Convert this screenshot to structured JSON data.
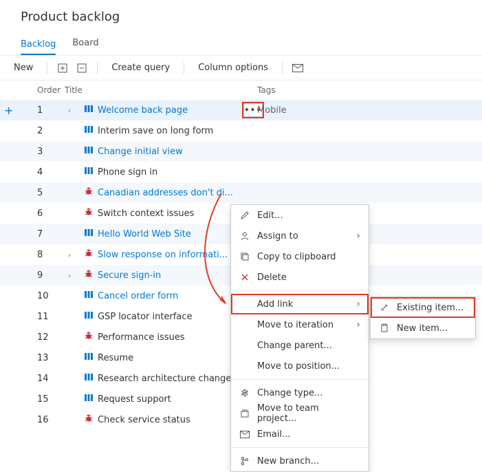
{
  "page": {
    "title": "Product backlog"
  },
  "tabs": {
    "active": "Backlog",
    "items": [
      "Backlog",
      "Board"
    ]
  },
  "toolbar": {
    "new": "New",
    "create_query": "Create query",
    "column_options": "Column options"
  },
  "columns": {
    "order": "Order",
    "title": "Title",
    "tags": "Tags"
  },
  "rows": [
    {
      "order": 1,
      "type": "pbi",
      "title": "Welcome back page",
      "link": true,
      "tag": "Mobile",
      "expand": true,
      "selected": true,
      "alt": true
    },
    {
      "order": 2,
      "type": "pbi",
      "title": "Interim save on long form"
    },
    {
      "order": 3,
      "type": "pbi",
      "title": "Change initial view",
      "link": true,
      "alt": true
    },
    {
      "order": 4,
      "type": "pbi",
      "title": "Phone sign in"
    },
    {
      "order": 5,
      "type": "bug",
      "title": "Canadian addresses don't di...",
      "link": true,
      "alt": true
    },
    {
      "order": 6,
      "type": "bug",
      "title": "Switch context issues"
    },
    {
      "order": 7,
      "type": "pbi",
      "title": "Hello World Web Site",
      "link": true,
      "alt": true
    },
    {
      "order": 8,
      "type": "bug",
      "title": "Slow response on informati...",
      "link": true,
      "expand": true
    },
    {
      "order": 9,
      "type": "bug",
      "title": "Secure sign-in",
      "link": true,
      "expand": true,
      "alt": true
    },
    {
      "order": 10,
      "type": "pbi",
      "title": "Cancel order form",
      "link": true
    },
    {
      "order": 11,
      "type": "pbi",
      "title": "GSP locator interface"
    },
    {
      "order": 12,
      "type": "bug",
      "title": "Performance issues"
    },
    {
      "order": 13,
      "type": "pbi",
      "title": "Resume"
    },
    {
      "order": 14,
      "type": "pbi",
      "title": "Research architecture changes"
    },
    {
      "order": 15,
      "type": "pbi",
      "title": "Request support"
    },
    {
      "order": 16,
      "type": "bug",
      "title": "Check service status"
    }
  ],
  "contextMenu": {
    "edit": "Edit...",
    "assign_to": "Assign to",
    "copy": "Copy to clipboard",
    "delete": "Delete",
    "add_link": "Add link",
    "move_iteration": "Move to iteration",
    "change_parent": "Change parent...",
    "move_position": "Move to position...",
    "change_type": "Change type...",
    "move_team_project": "Move to team project...",
    "email": "Email...",
    "new_branch": "New branch..."
  },
  "submenu": {
    "existing": "Existing item...",
    "new_item": "New item..."
  }
}
